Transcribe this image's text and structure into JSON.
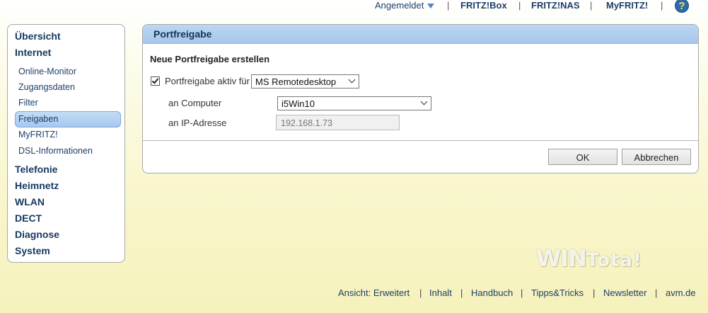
{
  "topnav": {
    "logged_in": "Angemeldet",
    "fritzbox": "FRITZ!Box",
    "fritznas": "FRITZ!NAS",
    "myfritz": "MyFRITZ!",
    "help": "?",
    "sep": "|"
  },
  "sidebar": {
    "items": [
      {
        "label": "Übersicht"
      },
      {
        "label": "Internet"
      },
      {
        "label": "Online-Monitor"
      },
      {
        "label": "Zugangsdaten"
      },
      {
        "label": "Filter"
      },
      {
        "label": "Freigaben"
      },
      {
        "label": "MyFRITZ!"
      },
      {
        "label": "DSL-Informationen"
      },
      {
        "label": "Telefonie"
      },
      {
        "label": "Heimnetz"
      },
      {
        "label": "WLAN"
      },
      {
        "label": "DECT"
      },
      {
        "label": "Diagnose"
      },
      {
        "label": "System"
      }
    ]
  },
  "panel": {
    "title": "Portfreigabe",
    "section_title": "Neue Portfreigabe erstellen",
    "checkbox_label": "Portfreigabe aktiv für",
    "checkbox_checked": true,
    "app_select_value": "MS Remotedesktop",
    "computer_label": "an Computer",
    "computer_select_value": "i5Win10",
    "ip_label": "an IP-Adresse",
    "ip_value": "192.168.1.73",
    "ok_label": "OK",
    "cancel_label": "Abbrechen"
  },
  "watermark": {
    "text_main": "WIN",
    "text_small": "Tota!"
  },
  "footer": {
    "view": "Ansicht: Erweitert",
    "content": "Inhalt",
    "manual": "Handbuch",
    "tips": "Tipps&Tricks",
    "newsletter": "Newsletter",
    "avm": "avm.de",
    "sep": "|"
  },
  "colors": {
    "link": "#1d3e68",
    "active_nav": "#a7c9ef",
    "panel_header": "#bcd6f2"
  }
}
